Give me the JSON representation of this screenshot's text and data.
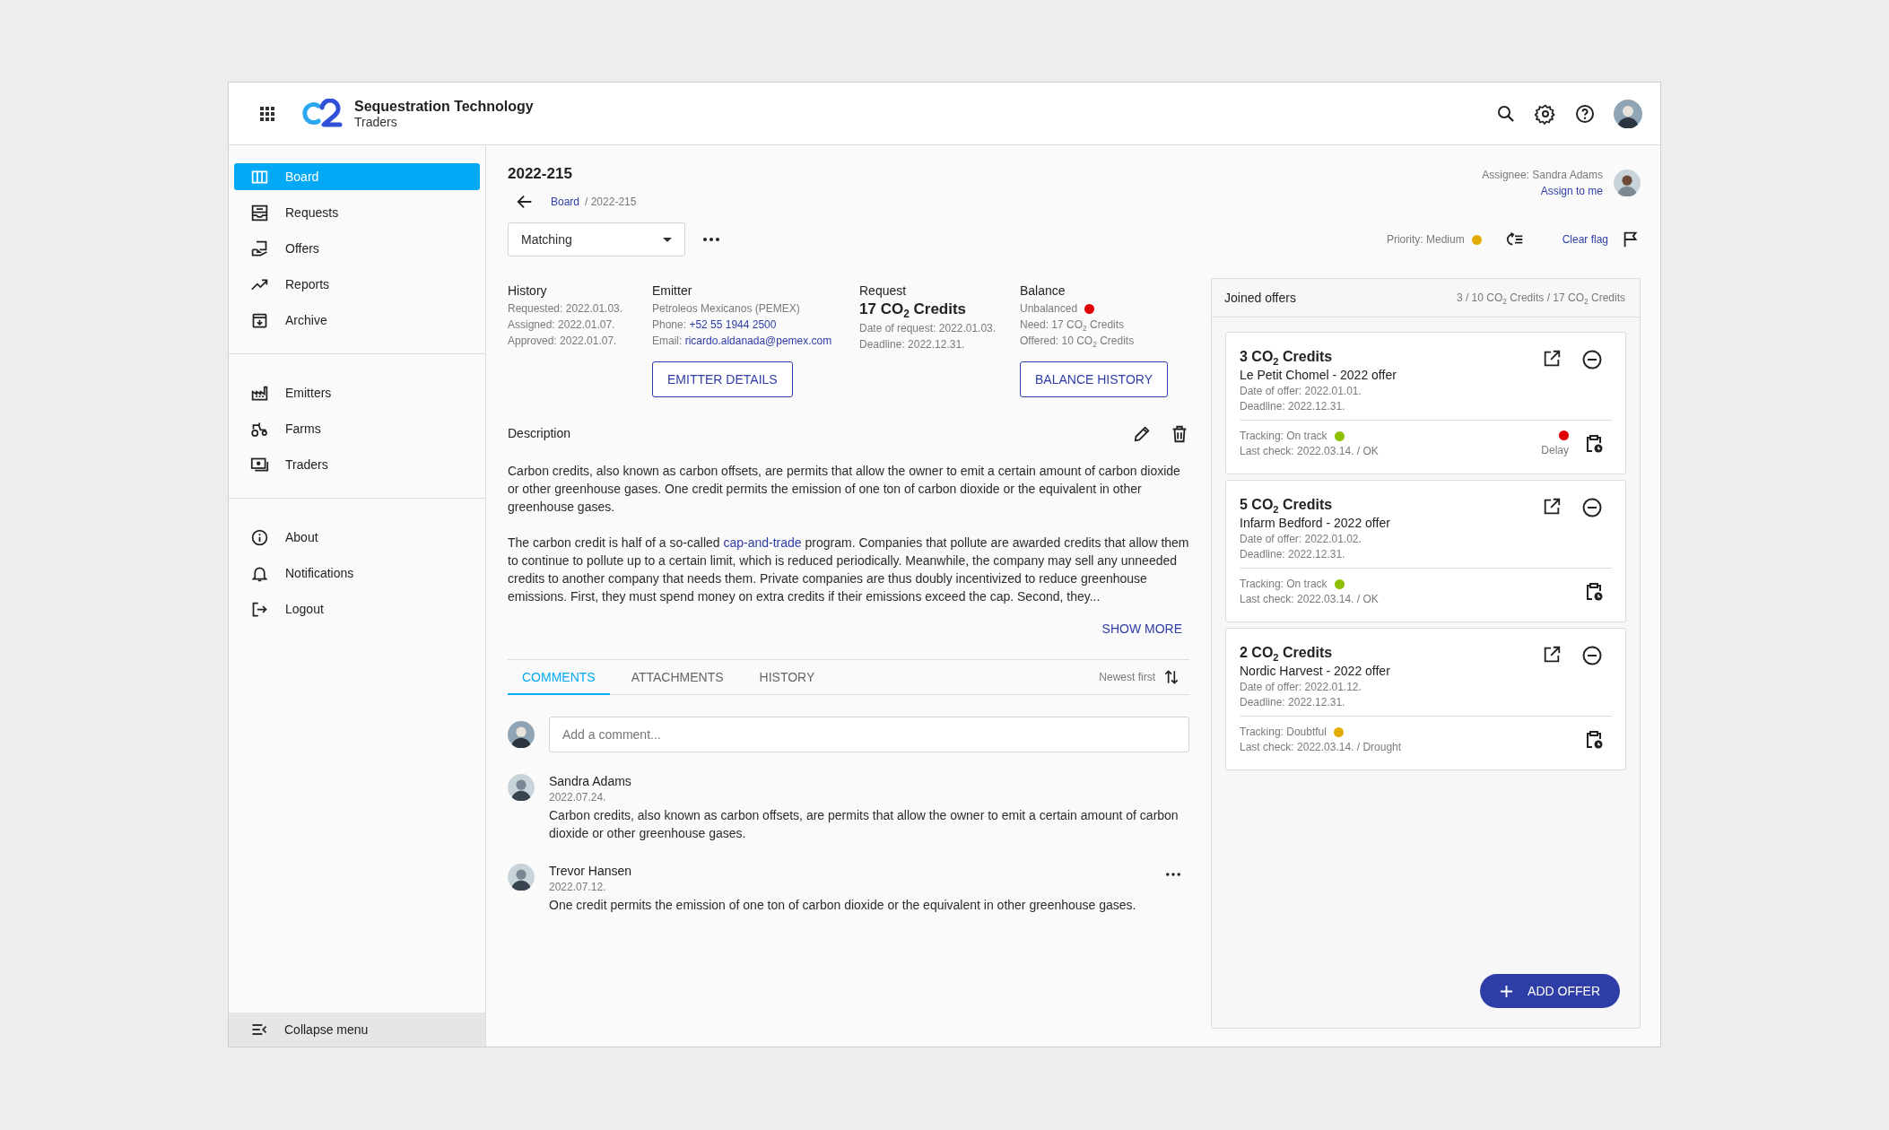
{
  "header": {
    "app_title": "Sequestration Technology",
    "app_subtitle": "Traders"
  },
  "sidebar": {
    "groups": [
      [
        {
          "label": "Board",
          "selected": true
        },
        {
          "label": "Requests",
          "selected": false
        },
        {
          "label": "Offers",
          "selected": false
        },
        {
          "label": "Reports",
          "selected": false
        },
        {
          "label": "Archive",
          "selected": false
        }
      ],
      [
        {
          "label": "Emitters",
          "selected": false
        },
        {
          "label": "Farms",
          "selected": false
        },
        {
          "label": "Traders",
          "selected": false
        }
      ],
      [
        {
          "label": "About",
          "selected": false
        },
        {
          "label": "Notifications",
          "selected": false
        },
        {
          "label": "Logout",
          "selected": false
        }
      ]
    ],
    "collapse_label": "Collapse menu"
  },
  "ticket": {
    "title": "2022-215",
    "breadcrumb": {
      "link": "Board",
      "current": "/ 2022-215"
    },
    "assignee": {
      "label": "Assignee: Sandra Adams",
      "action": "Assign to me"
    },
    "status_select": {
      "value": "Matching"
    },
    "priority": {
      "label": "Priority: Medium",
      "color": "#e2ad00"
    },
    "flag_action": "Clear flag"
  },
  "info": {
    "history": {
      "heading": "History",
      "lines": [
        "Requested: 2022.01.03.",
        "Assigned: 2022.01.07.",
        "Approved: 2022.01.07."
      ]
    },
    "emitter": {
      "heading": "Emitter",
      "company": "Petroleos Mexicanos (PEMEX)",
      "phone_label": "Phone:",
      "phone": "+52 55 1944 2500",
      "email_label": "Email:",
      "email": "ricardo.aldanada@pemex.com",
      "button": "EMITTER DETAILS"
    },
    "request": {
      "heading": "Request",
      "amount": "17 CO$_{2}$ Credits",
      "lines": [
        "Date of request: 2022.01.03.",
        "Deadline: 2022.12.31."
      ]
    },
    "balance": {
      "heading": "Balance",
      "status": "Unbalanced",
      "color": "#e00000",
      "lines": [
        "Need: 17 CO$_{2}$ Credits",
        "Offered: 10 CO$_{2}$ Credits"
      ],
      "button": "BALANCE HISTORY"
    }
  },
  "description": {
    "heading": "Description",
    "paragraphs": [
      [
        {
          "kind": "text",
          "text": "Carbon credits, also known as carbon offsets, are permits that allow the owner to emit a certain amount of carbon dioxide or other greenhouse gases. One credit permits the emission of one ton of carbon dioxide or the equivalent in other greenhouse gases."
        }
      ],
      [
        {
          "kind": "text",
          "text": "The carbon credit is half of a so-called "
        },
        {
          "kind": "link",
          "text": "cap-and-trade"
        },
        {
          "kind": "text",
          "text": " program. Companies that pollute are awarded credits that allow them to continue to pollute up to a certain limit, which is reduced periodically. Meanwhile, the company may sell any unneeded credits to another company that needs them. Private companies are thus doubly incentivized to reduce greenhouse emissions. First, they must spend money on extra credits if their emissions exceed the cap. Second, they..."
        }
      ]
    ],
    "more": "SHOW MORE"
  },
  "tabs": [
    {
      "label": "COMMENTS",
      "selected": true
    },
    {
      "label": "ATTACHMENTS",
      "selected": false
    },
    {
      "label": "HISTORY",
      "selected": false
    }
  ],
  "sort_label": "Newest first",
  "comment_input": {
    "placeholder": "Add a comment..."
  },
  "comments": [
    {
      "author": "Sandra Adams",
      "date": "2022.07.24.",
      "text": "Carbon credits, also known as carbon offsets, are permits that allow the owner to emit a certain amount of carbon dioxide or other greenhouse gases.",
      "menu": false
    },
    {
      "author": "Trevor Hansen",
      "date": "2022.07.12.",
      "text": "One credit permits the emission of one ton of carbon dioxide or the equivalent in other greenhouse gases.",
      "menu": true
    }
  ],
  "offers": {
    "title": "Joined offers",
    "summary": "3 / 10 CO$_{2}$ Credits / 17 CO$_{2}$ Credits",
    "cards": [
      {
        "credits": "3 CO$_{2}$ Credits",
        "name": "Le Petit Chomel - 2022 offer",
        "date": "Date of offer: 2022.01.01.",
        "deadline": "Deadline: 2022.12.31.",
        "tracking": "Tracking: On track",
        "color": "#8cc000",
        "last_check": "Last check: 2022.03.14. / OK",
        "delay": {
          "label": "Delay",
          "color": "#e00000"
        }
      },
      {
        "credits": "5 CO$_{2}$ Credits",
        "name": "Infarm Bedford - 2022 offer",
        "date": "Date of offer: 2022.01.02.",
        "deadline": "Deadline: 2022.12.31.",
        "tracking": "Tracking: On track",
        "color": "#8cc000",
        "last_check": "Last check: 2022.03.14. / OK"
      },
      {
        "credits": "2 CO$_{2}$ Credits",
        "name": "Nordic Harvest - 2022 offer",
        "date": "Date of offer: 2022.01.12.",
        "deadline": "Deadline: 2022.12.31.",
        "tracking": "Tracking: Doubtful",
        "color": "#e2ad00",
        "last_check": "Last check: 2022.03.14. / Drought"
      }
    ],
    "add_button": "ADD OFFER"
  }
}
